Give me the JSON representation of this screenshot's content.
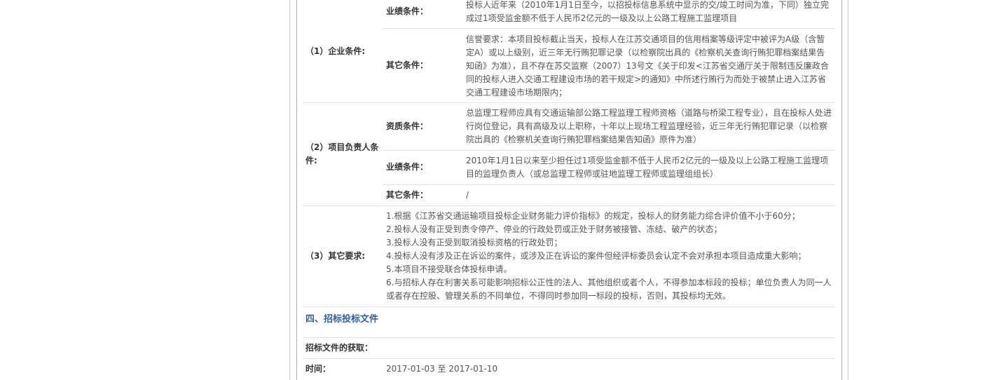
{
  "enterprise": {
    "label": "（1）企业条件:",
    "performance_label": "业绩条件：",
    "performance_text": "投标人近年来（2010年1月1日至今，以招投标信息系统中显示的交/竣工时间为准，下同）独立完成过1项受监金额不低于人民币2亿元的一级及以上公路工程施工监理项目",
    "other_label": "其它条件：",
    "other_text": "信誉要求：本项目投标截止当天，投标人在江苏交通项目的信用档案等级评定中被评为A级（含暂定A）或以上级别，近三年无行贿犯罪记录（以检察院出具的《检察机关查询行贿犯罪档案结果告知函》为准），且不存在苏交监察（2007）13号文《关于印发<江苏省交通厅关于限制违反廉政合同的投标人进入交通工程建设市场的若干规定>的通知》中所述行贿行为而处于被禁止进入江苏省交通工程建设市场期限内；"
  },
  "manager": {
    "label": "（2）项目负责人条件:",
    "qualification_label": "资质条件：",
    "qualification_text": "总监理工程师应具有交通运输部公路工程监理工程师资格（道路与桥梁工程专业），且在投标人处进行岗位登记，具有高级及以上职称，十年以上现场工程监理经验，近三年无行贿犯罪记录（以检察院出具的《检察机关查询行贿犯罪档案结果告知函》原件为准）",
    "performance_label": "业绩条件：",
    "performance_text": "2010年1月1日以来至少担任过1项受监金额不低于人民币2亿元的一级及以上公路工程施工监理项目的监理负责人（或总监理工程师或驻地监理工程师或监理组组长）",
    "other_label": "其它条件：",
    "other_text": "/"
  },
  "other_req": {
    "label": "（3）其它要求:",
    "items": [
      "1.根据《江苏省交通运输项目投标企业财务能力评价指标》的规定，投标人的财务能力综合评价值不小于60分；",
      "2.投标人没有正受到责令停产、停业的行政处罚或正处于财务被接管、冻结、破产的状态；",
      "3.投标人没有正受到取消投标资格的行政处罚；",
      "4.投标人没有涉及正在诉讼的案件，或涉及正在诉讼的案件但经评标委员会认定不会对承担本项目造成重大影响；",
      "5.本项目不接受联合体投标申请。",
      "6.与招标人存在利害关系可能影响招标公正性的法人、其他组织或者个人，不得参加本标段的投标；单位负责人为同一人或者存在控股、管理关系的不同单位，不得同时参加同一标段的投标，否则，其投标均无效。"
    ]
  },
  "section4": {
    "title": "四、招标投标文件",
    "obtain_label": "招标文件的获取：",
    "time_label": "时间：",
    "time_value": "2017-01-03 至 2017-01-10"
  }
}
